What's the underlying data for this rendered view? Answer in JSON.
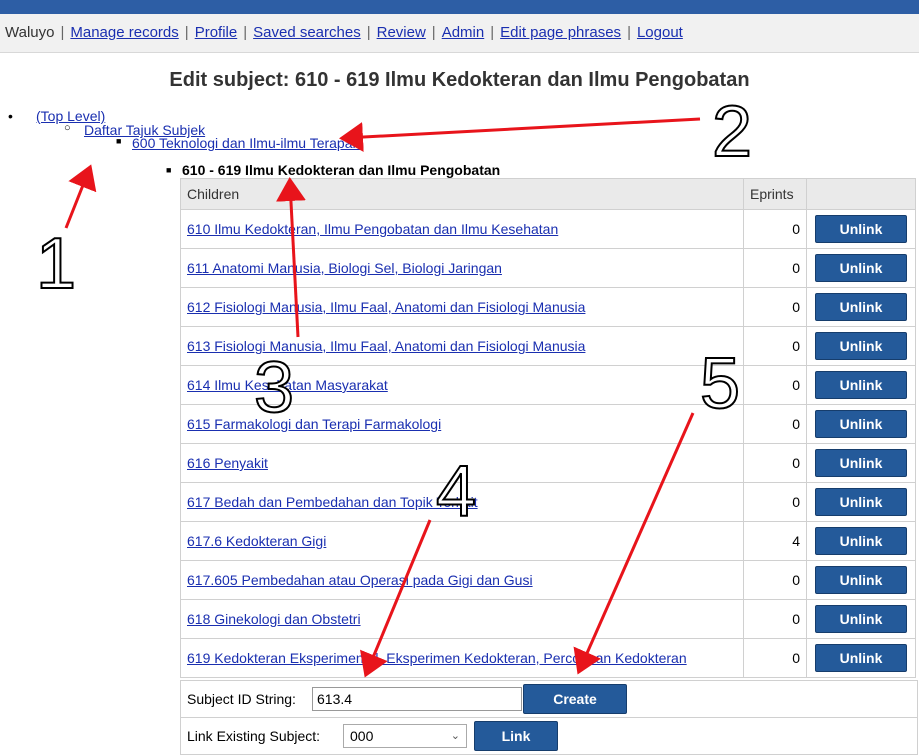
{
  "nav": {
    "user": "Waluyo",
    "links": [
      "Manage records",
      "Profile",
      "Saved searches",
      "Review",
      "Admin",
      "Edit page phrases",
      "Logout"
    ]
  },
  "page_title": "Edit subject: 610 - 619 Ilmu Kedokteran dan Ilmu Pengobatan",
  "breadcrumb": {
    "top_level": "(Top Level)",
    "level1": "Daftar Tajuk Subjek",
    "level2": "600 Teknologi dan Ilmu-ilmu Terapan",
    "current": "610 - 619 Ilmu Kedokteran dan Ilmu Pengobatan"
  },
  "table": {
    "headers": {
      "children": "Children",
      "eprints": "Eprints",
      "action": ""
    },
    "rows": [
      {
        "name": "610 Ilmu Kedokteran, Ilmu Pengobatan dan Ilmu Kesehatan",
        "eprints": "0",
        "action": "Unlink"
      },
      {
        "name": "611 Anatomi Manusia, Biologi Sel, Biologi Jaringan",
        "eprints": "0",
        "action": "Unlink"
      },
      {
        "name": "612 Fisiologi Manusia, Ilmu Faal, Anatomi dan Fisiologi Manusia",
        "eprints": "0",
        "action": "Unlink"
      },
      {
        "name": "613 Fisiologi Manusia, Ilmu Faal, Anatomi dan Fisiologi Manusia",
        "eprints": "0",
        "action": "Unlink"
      },
      {
        "name": "614 Ilmu Kesehatan Masyarakat",
        "eprints": "0",
        "action": "Unlink"
      },
      {
        "name": "615 Farmakologi dan Terapi Farmakologi",
        "eprints": "0",
        "action": "Unlink"
      },
      {
        "name": "616 Penyakit",
        "eprints": "0",
        "action": "Unlink"
      },
      {
        "name": "617 Bedah dan Pembedahan dan Topik Terkait",
        "eprints": "0",
        "action": "Unlink"
      },
      {
        "name": "617.6 Kedokteran Gigi",
        "eprints": "4",
        "action": "Unlink"
      },
      {
        "name": "617.605 Pembedahan atau Operasi pada Gigi dan Gusi",
        "eprints": "0",
        "action": "Unlink"
      },
      {
        "name": "618 Ginekologi dan Obstetri",
        "eprints": "0",
        "action": "Unlink"
      },
      {
        "name": "619 Kedokteran Eksperimental, Eksperimen Kedokteran, Percobaan Kedokteran",
        "eprints": "0",
        "action": "Unlink"
      }
    ]
  },
  "create_form": {
    "label": "Subject ID String:",
    "value": "613.4",
    "button": "Create"
  },
  "link_form": {
    "label": "Link Existing Subject:",
    "selected": "000",
    "button": "Link"
  },
  "annotations": [
    "1",
    "2",
    "3",
    "4",
    "5"
  ],
  "colors": {
    "accent": "#245a9a",
    "annotation_red": "#e8141b",
    "top_bar": "#2d5ea5"
  }
}
